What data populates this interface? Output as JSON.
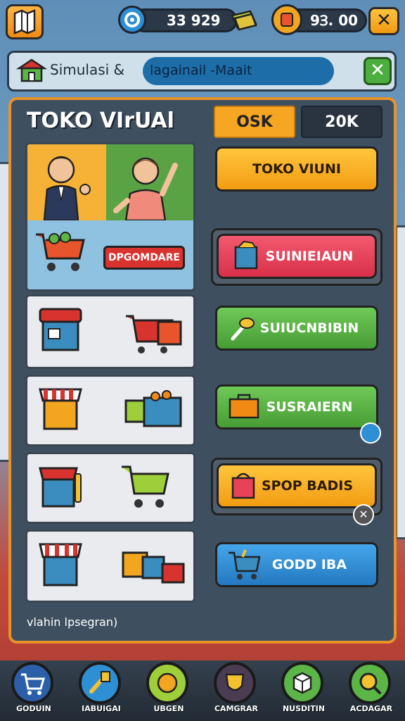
{
  "topbar": {
    "currency1": "33 929",
    "currency2": "9Ɜ. 00",
    "close_symbol": "✕"
  },
  "search": {
    "prefix": "Simulasi  &",
    "field_value": "lagainail -Maait",
    "close_symbol": "✕"
  },
  "panel": {
    "title": "TOKO VIrUAl",
    "tabs": [
      {
        "label": "OSK",
        "active": true
      },
      {
        "label": "20K",
        "active": false
      }
    ],
    "banner_label": "DPGOMDARE",
    "footer": "vlahin lpsegran)"
  },
  "buttons": [
    {
      "label": "TOKO VIUNI",
      "color": "#f6b124"
    },
    {
      "label": "SUINIEIAUN",
      "color": "#e84257"
    },
    {
      "label": "SUIUCNBIBIN",
      "color": "#5cb547"
    },
    {
      "label": "SUSRAIERN",
      "color": "#5cb547"
    },
    {
      "label": "SPOP BADIS",
      "color": "#f6b124"
    },
    {
      "label": "GODD IBA",
      "color": "#2f8fd4"
    }
  ],
  "nav": [
    {
      "label": "GODUIN",
      "color": "#2b5fa8",
      "icon": "cart-icon"
    },
    {
      "label": "IABUIGAI",
      "color": "#2f8fd4",
      "icon": "brush-icon"
    },
    {
      "label": "UBGEN",
      "color": "#9ecf3a",
      "icon": "badge-icon"
    },
    {
      "label": "CAMGRAR",
      "color": "#4a3c52",
      "icon": "shield-icon"
    },
    {
      "label": "NUSDITIN",
      "color": "#5cb547",
      "icon": "box-icon"
    },
    {
      "label": "ACDAGAR",
      "color": "#5cb547",
      "icon": "search-coin-icon"
    }
  ]
}
